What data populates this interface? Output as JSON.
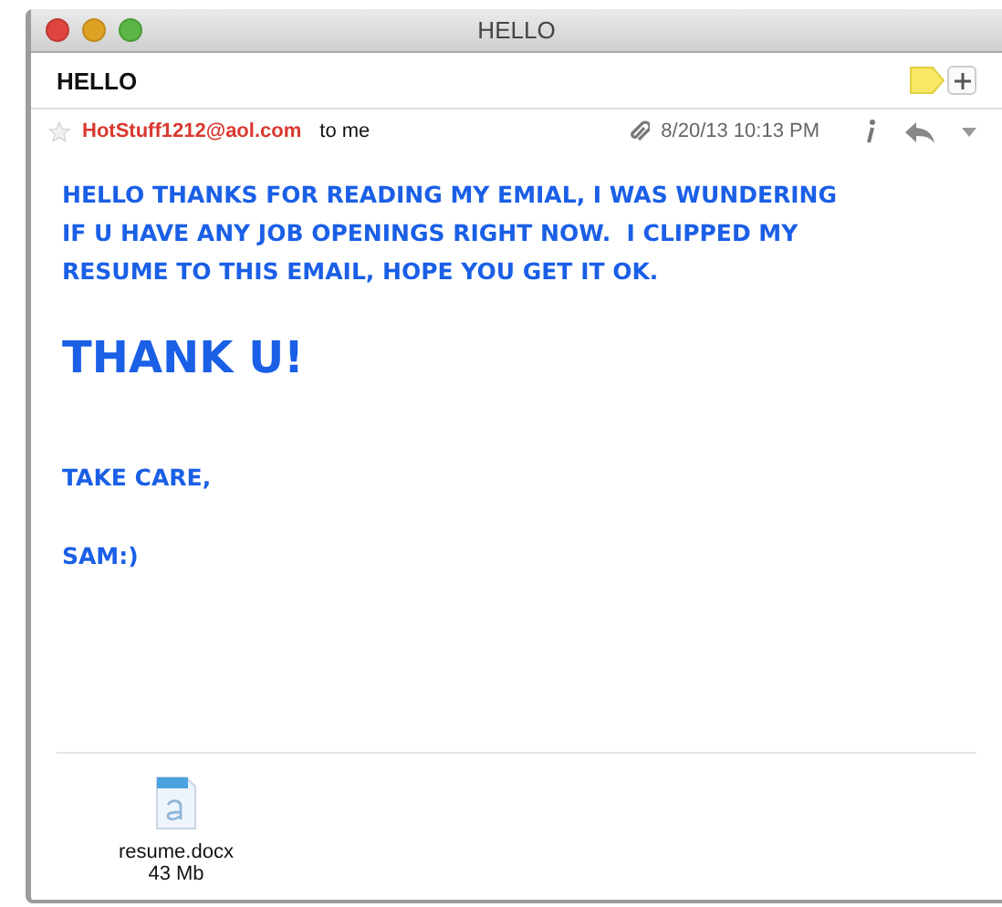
{
  "window": {
    "title": "HELLO"
  },
  "subject": "HELLO",
  "message": {
    "starred": false,
    "sender": "HotStuff1212@aol.com",
    "recipient": "to me",
    "date": "8/20/13 10:13 PM",
    "body": [
      {
        "kind": "paragraph",
        "lines": [
          "HELLO THANKS FOR READING MY EMIAL, I WAS WUNDERING",
          "IF U HAVE ANY JOB OPENINGS RIGHT NOW.  I CLIPPED MY",
          "RESUME TO THIS EMAIL, HOPE YOU GET IT OK."
        ]
      },
      {
        "kind": "heading",
        "lines": [
          "THANK U!"
        ]
      },
      {
        "kind": "paragraph",
        "lines": [
          "TAKE CARE,"
        ]
      },
      {
        "kind": "paragraph",
        "lines": [
          "SAM:)"
        ]
      }
    ]
  },
  "attachments": [
    {
      "name": "resume.docx",
      "size": "43 Mb"
    }
  ]
}
